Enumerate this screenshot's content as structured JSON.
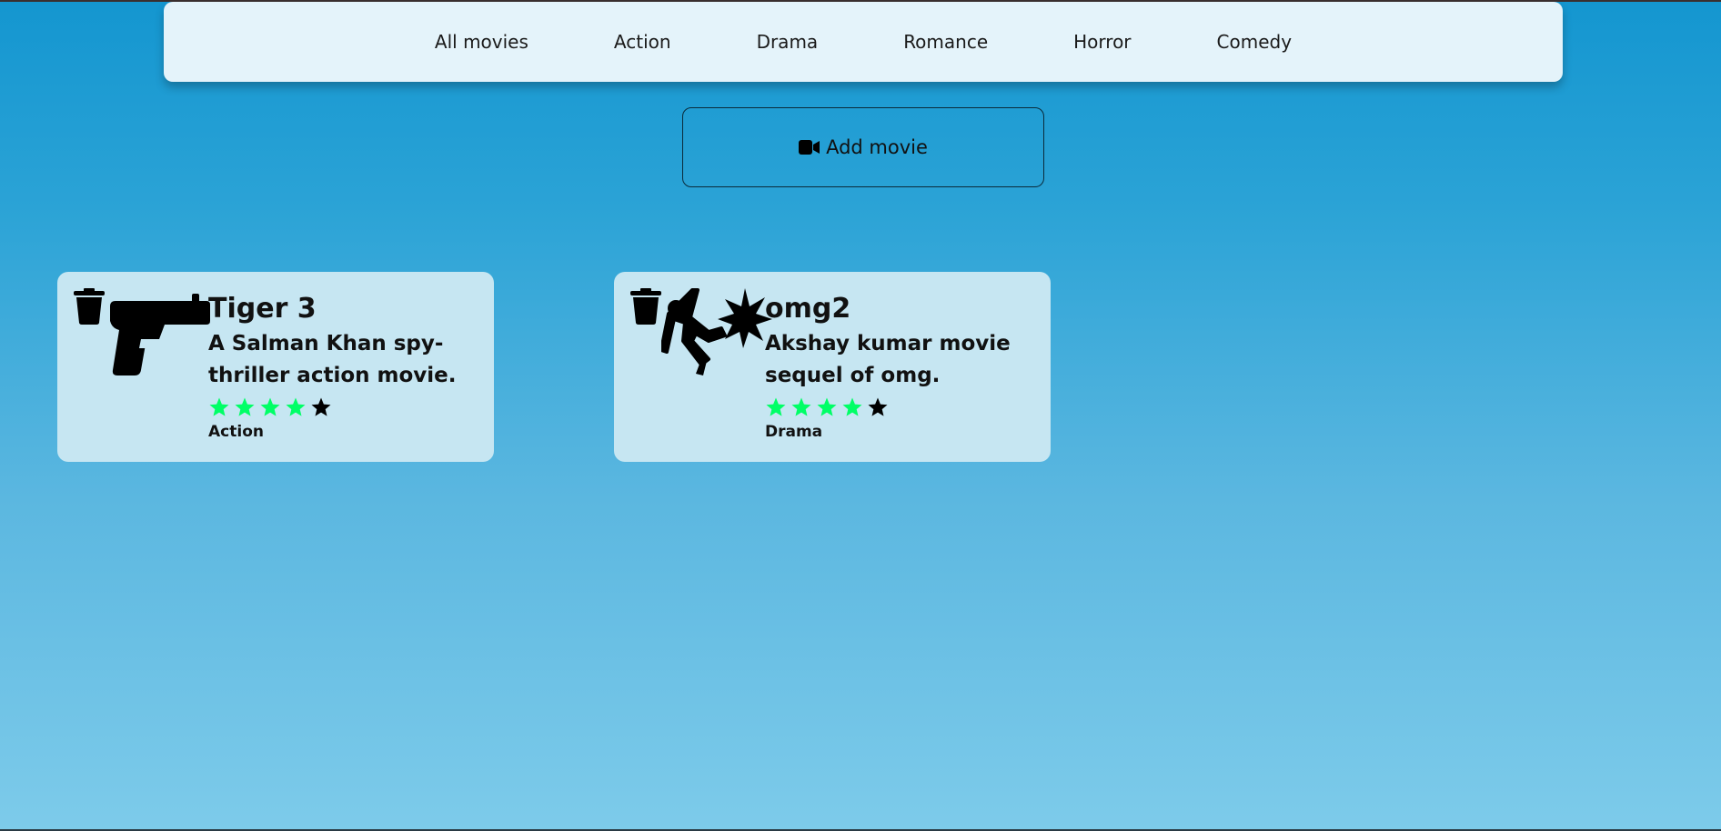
{
  "nav": {
    "items": [
      {
        "label": "All movies"
      },
      {
        "label": "Action"
      },
      {
        "label": "Drama"
      },
      {
        "label": "Romance"
      },
      {
        "label": "Horror"
      },
      {
        "label": "Comedy"
      }
    ]
  },
  "add_button": {
    "label": "Add movie",
    "icon": "video-camera-icon"
  },
  "movies": [
    {
      "title": "Tiger 3",
      "description": "A Salman Khan spy-thriller action movie.",
      "rating": 4,
      "max_rating": 5,
      "genre": "Action",
      "icon": "gun-icon"
    },
    {
      "title": "omg2",
      "description": "Akshay kumar movie sequel of omg.",
      "rating": 4,
      "max_rating": 5,
      "genre": "Drama",
      "icon": "person-falling-burst-icon"
    }
  ],
  "colors": {
    "star_filled": "#00ff66",
    "star_empty": "#000000",
    "card_bg": "#c6e6f2",
    "nav_bg": "#e4f3fa"
  }
}
